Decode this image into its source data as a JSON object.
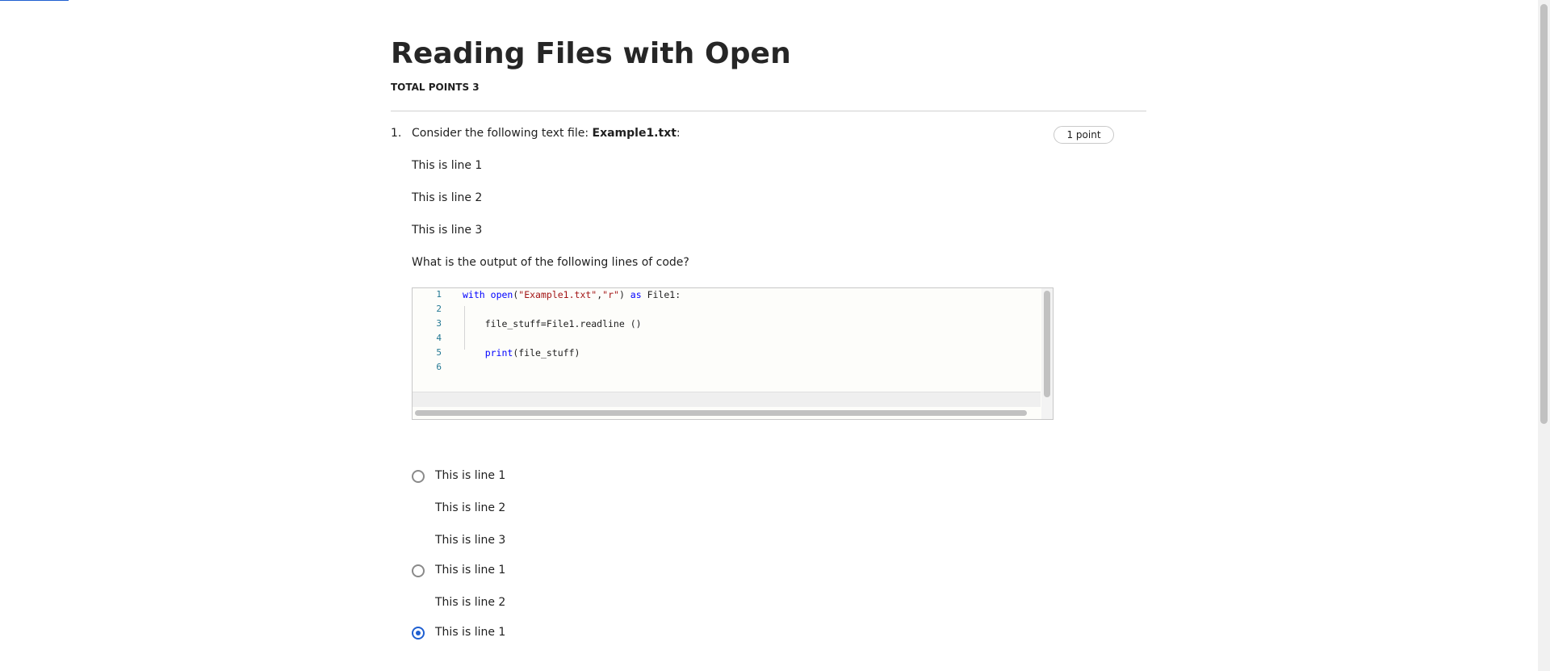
{
  "assignment": {
    "title": "Reading Files with Open",
    "total_points": "TOTAL POINTS 3"
  },
  "question1": {
    "number": "1.",
    "points": "1 point",
    "intro_prefix": "Consider the following text file: ",
    "intro_file": "Example1.txt",
    "intro_suffix": ":",
    "file_lines": [
      "This is line 1",
      "This is line 2",
      "This is line 3"
    ],
    "prompt": "What is the output of the following lines of code?",
    "code": {
      "line_numbers": [
        "1",
        "2",
        "3",
        "4",
        "5",
        "6"
      ],
      "line1": {
        "kw_with": "with",
        "fn_open": "open",
        "p1": "(",
        "s1": "\"Example1.txt\"",
        "comma": ",",
        "s2": "\"r\"",
        "p2": ") ",
        "kw_as": "as",
        "rest": " File1:"
      },
      "line3": "    file_stuff=File1.readline ()",
      "line5": {
        "indent": "    ",
        "fn_print": "print",
        "rest": "(file_stuff)"
      }
    },
    "options": [
      {
        "lines": [
          "This is line 1",
          "This is line 2",
          "This is line 3"
        ],
        "selected": false
      },
      {
        "lines": [
          "This is line 1",
          "This is line 2"
        ],
        "selected": false
      },
      {
        "lines": [
          "This is line 1"
        ],
        "selected": true
      }
    ]
  },
  "colors": {
    "accent": "#1f5fd1",
    "keyword": "#0000ff",
    "string": "#a31515",
    "line_number": "#237893"
  },
  "icons": {
    "radio_unchecked": "radio-unchecked-icon",
    "radio_checked": "radio-checked-icon"
  }
}
